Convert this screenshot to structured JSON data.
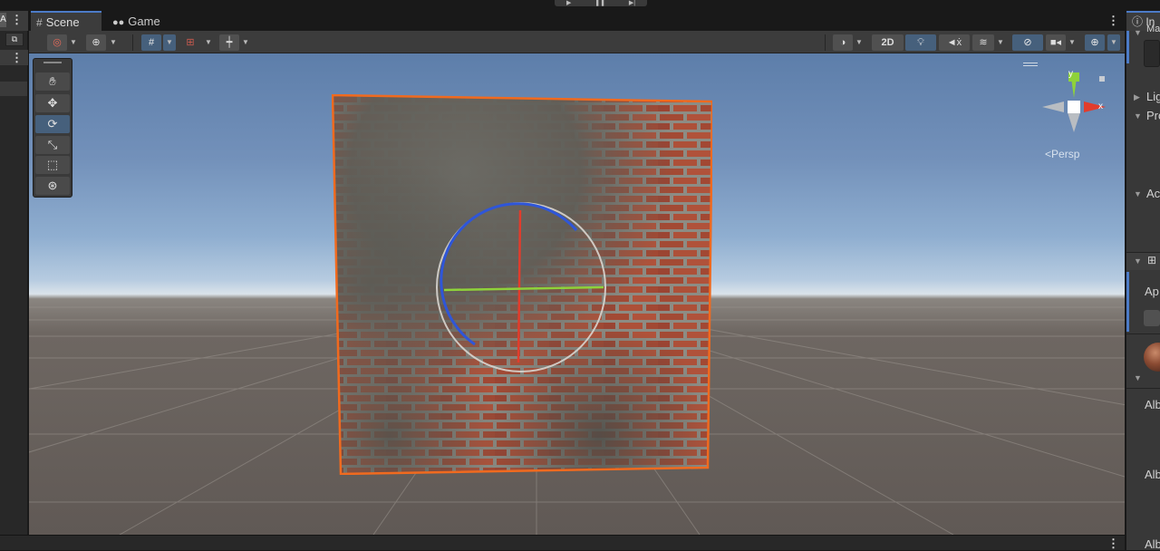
{
  "playbar": {
    "play_icon": "play-icon",
    "pause_icon": "pause-icon",
    "step_icon": "step-icon"
  },
  "left_panel": {
    "header_letter": "A",
    "kebab": "⋮",
    "button_glyph": "⧉"
  },
  "tabs": [
    {
      "label": "Scene",
      "icon": "hash-icon",
      "active": true
    },
    {
      "label": "Game",
      "icon": "gamepad-icon",
      "active": false
    }
  ],
  "tab_menu": "⋮",
  "toolbar": {
    "mode_2d_label": "2D",
    "left_buttons": [
      "draw-mode",
      "global-local",
      "grid-snap",
      "snap-increment",
      "ruler"
    ],
    "right_buttons": [
      "shading",
      "2d",
      "lighting",
      "audio",
      "effects",
      "hidden-objects",
      "camera",
      "gizmos"
    ]
  },
  "tools": [
    "hand-tool",
    "move-tool",
    "rotate-tool",
    "scale-tool",
    "rect-tool",
    "transform-tool"
  ],
  "active_tool": "rotate-tool",
  "gizmo": {
    "label": "Persp",
    "x_label": "x",
    "y_label": "y"
  },
  "colors": {
    "accent": "#4c7bc7",
    "selection_outline": "#f06a1f",
    "x_axis": "#e23c2c",
    "y_axis": "#8ed23a",
    "z_axis": "#2f56d8"
  },
  "inspector": {
    "tab_label": "In",
    "rows": [
      "Ma",
      "Lig",
      "Pro",
      "Ac",
      "Ap",
      "Alb",
      "Alb",
      "Alb"
    ]
  },
  "bottom_menu": "⋮"
}
